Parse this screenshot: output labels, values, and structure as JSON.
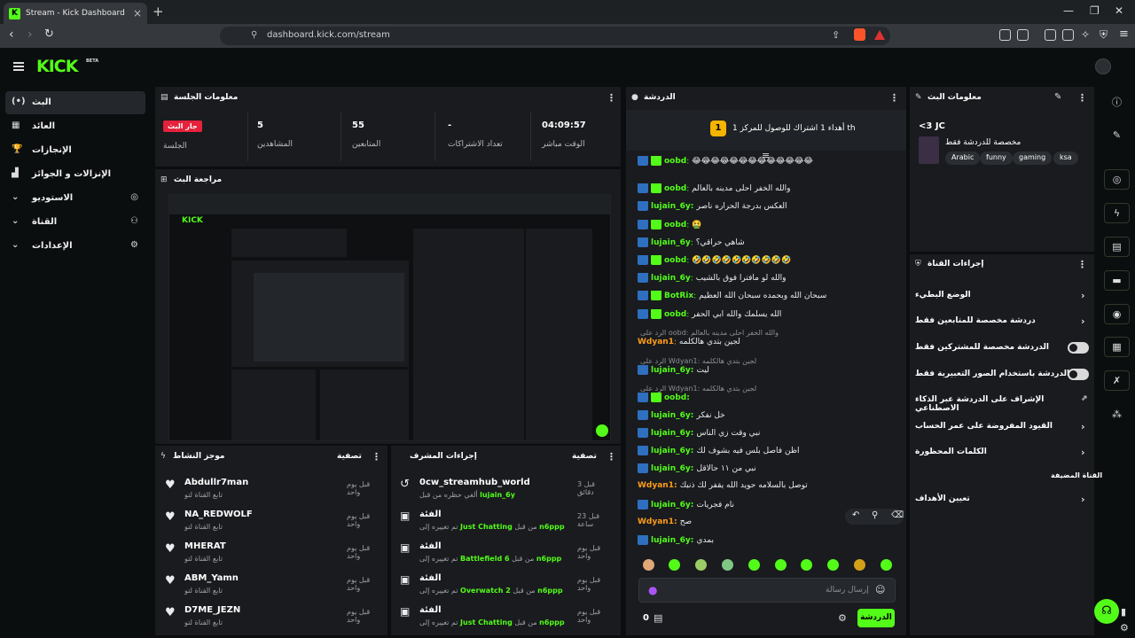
{
  "browser": {
    "tab_title": "Stream - Kick Dashboard",
    "tab_favicon": "K",
    "url": "dashboard.kick.com/stream"
  },
  "header": {
    "logo": "KICK",
    "beta": "BETA"
  },
  "sidebar": {
    "items": [
      {
        "label": "البث",
        "icon": "broadcast-icon",
        "glyph": "(•)"
      },
      {
        "label": "العائد",
        "icon": "revenue-icon",
        "glyph": "▦"
      },
      {
        "label": "الإنجازات",
        "icon": "trophy-icon",
        "glyph": "🏆"
      },
      {
        "label": "الإنزالات و الجوائز",
        "icon": "drops-icon",
        "glyph": "▟"
      },
      {
        "label": "الاستوديو",
        "icon": "studio-icon",
        "glyph": "⌄",
        "right": "◎"
      },
      {
        "label": "القناة",
        "icon": "channel-icon",
        "glyph": "⌄",
        "right": "⚇"
      },
      {
        "label": "الإعدادات",
        "icon": "settings-icon",
        "glyph": "⌄",
        "right": "⚙"
      }
    ]
  },
  "session": {
    "title": "معلومات الجلسة",
    "live_badge": "جار البث",
    "live_label": "الجلسة",
    "viewers_value": "5",
    "viewers_label": "المشاهدين",
    "followers_value": "55",
    "followers_label": "المتابعين",
    "subs_value": "-",
    "subs_label": "تعداد الاشتراكات",
    "uptime_value": "04:09:57",
    "uptime_label": "الوقت مباشر"
  },
  "preview": {
    "title": "مراجعة البث",
    "corner": "⊞"
  },
  "activity": {
    "title": "موجز النشاط",
    "filter": "تصفية",
    "items": [
      {
        "name": "Abdullr7man",
        "sub": "تابع القناة لتو",
        "time": "قبل يوم واحد"
      },
      {
        "name": "NA_REDWOLF",
        "sub": "تابع القناة لتو",
        "time": "قبل يوم واحد"
      },
      {
        "name": "MHERAT",
        "sub": "تابع القناة لتو",
        "time": "قبل يوم واحد"
      },
      {
        "name": "ABM_Yamn",
        "sub": "تابع القناة لتو",
        "time": "قبل يوم واحد"
      },
      {
        "name": "D7ME_JEZN",
        "sub": "تابع القناة لتو",
        "time": "قبل يوم واحد"
      }
    ]
  },
  "modactions": {
    "title": "إجراءات المشرف",
    "filter": "تصفية",
    "items": [
      {
        "name": "0cw_streamhub_world",
        "pre": "ألغي حظره من قبل",
        "actor": "lujain_6y",
        "game": "",
        "time": "قبل 3 دقائق"
      },
      {
        "name": "الفئة",
        "pre": "تم تغييره إلى",
        "game": "Just Chatting",
        "mid": "من قبل",
        "actor": "n6ppp",
        "time": "قبل 23 ساعة"
      },
      {
        "name": "الفئة",
        "pre": "تم تغييره إلى",
        "game": "Battlefield 6",
        "mid": "من قبل",
        "actor": "n6ppp",
        "time": "قبل يوم واحد"
      },
      {
        "name": "الفئة",
        "pre": "تم تغييره إلى",
        "game": "Overwatch 2",
        "mid": "من قبل",
        "actor": "n6ppp",
        "time": "قبل يوم واحد"
      },
      {
        "name": "الفئة",
        "pre": "تم تغييره إلى",
        "game": "Just Chatting",
        "mid": "من قبل",
        "actor": "n6ppp",
        "time": "قبل يوم واحد"
      }
    ]
  },
  "chat": {
    "title": "الدردشة",
    "pinned": "أهداء 1 اشتراك للوصول للمركز 1 th",
    "pinned_rank": "1",
    "messages": [
      {
        "user": "oobd",
        "color": "#53fc18",
        "mod": true,
        "text": "😂😂😂😂😂😂😂😂😂😂😂😂😂"
      },
      {
        "user": "oobd",
        "color": "#53fc18",
        "mod": true,
        "text": "والله الخفر احلى مدينه بالعالم"
      },
      {
        "user": "",
        "color": "",
        "mod": false,
        "text": "العكس بدرجة الحراره ناصر"
      },
      {
        "user": "lujain_6y",
        "color": "#53fc18",
        "mod": false,
        "text": ""
      },
      {
        "user": "oobd",
        "color": "#53fc18",
        "mod": true,
        "text": "🤮"
      },
      {
        "user": "lujain_6y",
        "color": "#53fc18",
        "mod": false,
        "text": "شاهي حراقي؟"
      },
      {
        "user": "oobd",
        "color": "#53fc18",
        "mod": true,
        "text": "🤣🤣🤣🤣🤣🤣🤣🤣🤣🤣"
      },
      {
        "user": "lujain_6y",
        "color": "#53fc18",
        "mod": false,
        "text": "والله لو مافترا فوق بالشيب"
      },
      {
        "user": "BotRix",
        "color": "#53fc18",
        "mod": true,
        "text": "سبحان الله وبحمده سبحان الله العظيم"
      },
      {
        "user": "oobd",
        "color": "#53fc18",
        "mod": true,
        "text": "الله يسلمك والله ابي الحفر"
      }
    ],
    "reply1": "الرد على oobd: والله الخفر احلى مدينه بالعالم",
    "m_wdyan1_user": "Wdyan1",
    "m_wdyan1_text": "لجين بتدي هالكلمه",
    "reply2": "الرد على Wdyan1: لجين بتدي هالكلمه",
    "m_lujain_a": "ليت",
    "reply3": "الرد على Wdyan1: لجين بتدي هالكلمه",
    "m_oobd_b": "",
    "m_lujain_b": "خل نفكر",
    "m_lujain_c": "نبي وقت زي الناس",
    "m_lujain_d": "اظن فاصل بلس فيه بشوف لك",
    "m_lujain_e": "نبي من ١١ حالاقل",
    "m_wdyan_c": "توصل بالسلامه حويد الله يقفر لك ذنبك",
    "m_lujain_f": "نام فجريات",
    "m_wdyan_d": "صح",
    "m_lujain_g": "بمدي",
    "input_placeholder": "إرسال رسالة",
    "send_label": "الدردشة",
    "count": "0"
  },
  "streaminfo": {
    "title": "معلومات البث",
    "stream_title": "<3 JC",
    "category": "مخصصة للدردشة فقط",
    "tags": [
      "Arabic",
      "funny",
      "gaming",
      "ksa"
    ]
  },
  "channelactions": {
    "title": "إجراءات القناة",
    "items": [
      {
        "label": "الوضع البطيء",
        "kind": "arrow"
      },
      {
        "label": "دردشة مخصصة للمتابعين فقط",
        "kind": "arrow"
      },
      {
        "label": "الدردشة مخصصة للمشتركين فقط",
        "kind": "toggle"
      },
      {
        "label": "الدردشة باستخدام الصور التعبيرية فقط",
        "kind": "toggle"
      },
      {
        "label": "الإشراف على الدردشة عبر الذكاء الاصطناعي",
        "kind": "link"
      },
      {
        "label": "القيود المفروضة على عمر الحساب",
        "kind": "arrow"
      },
      {
        "label": "الكلمات المحظورة",
        "kind": "arrow"
      }
    ],
    "section": "القناة المضيفة",
    "target": "تعيين الأهداف"
  },
  "colors": {
    "accent": "#53fc18",
    "live": "#e5213b",
    "panel": "#191b1f",
    "bg": "#0b0e0f",
    "wdyan": "#ff9c1a"
  }
}
